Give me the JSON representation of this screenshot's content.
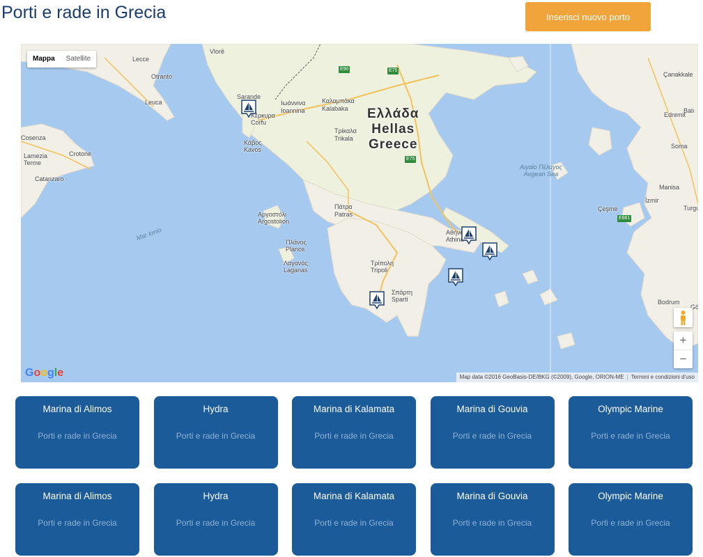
{
  "page": {
    "title": "Porti e rade in Grecia",
    "add_button": "Inserisci nuovo porto"
  },
  "map": {
    "type_controls": [
      "Mappa",
      "Satellite"
    ],
    "active_type": "Mappa",
    "country_label": [
      "Ελλάδα",
      "Hellas",
      "Greece"
    ],
    "place_labels": [
      {
        "id": "vlore",
        "text": "Vlorë"
      },
      {
        "id": "lecce",
        "text": "Lecce"
      },
      {
        "id": "otranto",
        "text": "Otranto"
      },
      {
        "id": "leuca",
        "text": "Leuca"
      },
      {
        "id": "cosenza",
        "text": "Cosenza"
      },
      {
        "id": "crotone",
        "text": "Crotone"
      },
      {
        "id": "lamezia",
        "text": "Lamezia\nTerme"
      },
      {
        "id": "catanzaro",
        "text": "Catanzaro"
      },
      {
        "id": "sarande",
        "text": "Sarande"
      },
      {
        "id": "kerkyra",
        "text": "Κέρκυρα\nCorfu"
      },
      {
        "id": "ioannina",
        "text": "Ιωάννινα\nIoannina"
      },
      {
        "id": "kalabaka",
        "text": "Καλαμπάκα\nKalabaka"
      },
      {
        "id": "trikala",
        "text": "Τρίκαλα\nTrikala"
      },
      {
        "id": "kavos",
        "text": "Κάβος\nKavos"
      },
      {
        "id": "argostoli",
        "text": "Αργοστόλι\nArgostolion"
      },
      {
        "id": "patra",
        "text": "Πάτρα\nPatras"
      },
      {
        "id": "planos",
        "text": "Πλάνος\nPlanos"
      },
      {
        "id": "laganas",
        "text": "Λαγανάς\nLaganas"
      },
      {
        "id": "tripoli",
        "text": "Τρίπολη\nTripoli"
      },
      {
        "id": "sparti",
        "text": "Σπάρτη\nSparti"
      },
      {
        "id": "athina",
        "text": "Αθήνα\nAthina"
      },
      {
        "id": "canakkale",
        "text": "Çanakkale"
      },
      {
        "id": "balikesir",
        "text": "Balı"
      },
      {
        "id": "edremit",
        "text": "Edremit"
      },
      {
        "id": "soma",
        "text": "Soma"
      },
      {
        "id": "manisa",
        "text": "Manisa"
      },
      {
        "id": "cesme",
        "text": "Çeşme"
      },
      {
        "id": "izmir",
        "text": "İzmir"
      },
      {
        "id": "turgutlu",
        "text": "Turgu"
      },
      {
        "id": "bodrum",
        "text": "Bodrum"
      },
      {
        "id": "gokova",
        "text": "Gö"
      }
    ],
    "sea_labels": [
      {
        "id": "ionio",
        "text": "Mar Ionio"
      },
      {
        "id": "aegean",
        "text": "Αιγαίο Πέλαγος\nAegean Sea"
      }
    ],
    "road_labels": [
      "E90",
      "E75",
      "E75",
      "E881"
    ],
    "zoom_in": "+",
    "zoom_out": "−",
    "google_logo": "Google",
    "attribution": "Map data ©2016 GeoBasis-DE/BKG (©2009), Google, ORION-ME",
    "terms": "Termini e condizioni d'uso",
    "marker_icon": "sailboat-icon",
    "marker_count": 5
  },
  "cards": [
    {
      "name": "Marina di Alimos",
      "subtitle": "Porti e rade in Grecia"
    },
    {
      "name": "Hydra",
      "subtitle": "Porti e rade in Grecia"
    },
    {
      "name": "Marina di Kalamata",
      "subtitle": "Porti e rade in Grecia"
    },
    {
      "name": "Marina di Gouvia",
      "subtitle": "Porti e rade in Grecia"
    },
    {
      "name": "Olympic Marine",
      "subtitle": "Porti e rade in Grecia"
    },
    {
      "name": "Marina di Alimos",
      "subtitle": "Porti e rade in Grecia"
    },
    {
      "name": "Hydra",
      "subtitle": "Porti e rade in Grecia"
    },
    {
      "name": "Marina di Kalamata",
      "subtitle": "Porti e rade in Grecia"
    },
    {
      "name": "Marina di Gouvia",
      "subtitle": "Porti e rade in Grecia"
    },
    {
      "name": "Olympic Marine",
      "subtitle": "Porti e rade in Grecia"
    }
  ],
  "colors": {
    "title": "#1a3d6e",
    "button": "#f0a43a",
    "card": "#1b5b9a",
    "card_subtitle": "#8fb3d6",
    "sea": "#a6c9ef",
    "land": "#f2efe6"
  }
}
